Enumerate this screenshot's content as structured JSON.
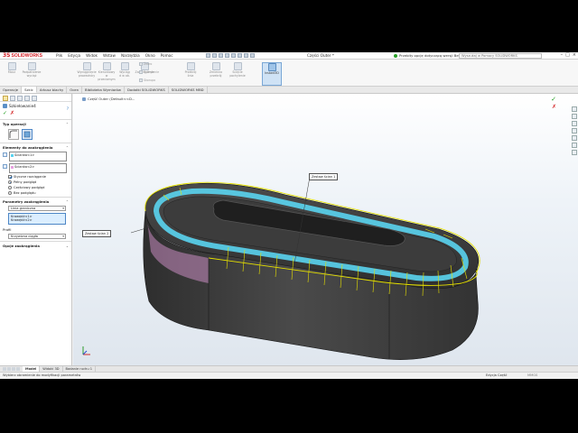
{
  "app": {
    "logo_mark": "3S",
    "logo_text": "SOLIDWORKS",
    "menu": [
      "Plik",
      "Edycja",
      "Widok",
      "Wstaw",
      "Narzędzia",
      "Okno",
      "Pomoc"
    ],
    "document_title": "Części Outer *",
    "status_text": "Przebity opcję dotyczącą wersji Beta",
    "search_placeholder": "Wyszukaj w Pomocy SOLIDWORKS",
    "win_controls": [
      "–",
      "□",
      "×"
    ]
  },
  "command_manager": {
    "large": [
      {
        "label": "Mocz",
        "icon": "mold-icon"
      },
      {
        "label": "Podpatrzenie\nwyciąż",
        "icon": "extrude-icon"
      },
      {
        "label": "Wyciągnięcie\nprowadnicy",
        "icon": "sweep-icon"
      },
      {
        "label": "Kierunkowy\nw przeciwnym",
        "icon": "direction-icon"
      },
      {
        "label": "Wyciąg\nd w ob.",
        "icon": "cut-icon"
      },
      {
        "label": "Zaokrąglenie",
        "icon": "fillet-icon"
      },
      {
        "label": "Szyk\nliniowy",
        "icon": "pattern-icon"
      },
      {
        "label": "Przekrój\nlinia",
        "icon": "section-icon"
      },
      {
        "label": "Zmienno\nprzekrój",
        "icon": "variable-icon"
      },
      {
        "label": "Ścięcie\npochylenie",
        "icon": "chamfer-icon"
      },
      {
        "label": "Wydaj\nkształt",
        "icon": "shape-icon"
      }
    ],
    "small": [
      {
        "label": "Żebro",
        "icon": "rib-icon"
      },
      {
        "label": "Pochylenie",
        "icon": "draft-icon"
      },
      {
        "label": "Skorupa",
        "icon": "shell-icon"
      },
      {
        "label": "Lustro odbicia",
        "icon": "mirror-icon"
      },
      {
        "label": "Wyrównanie",
        "icon": "wrap-icon"
      },
      {
        "label": "Przecięcie",
        "icon": "intersect-icon"
      }
    ],
    "active": {
      "label": "Instant3D",
      "icon": "instant3d-icon"
    }
  },
  "tabs": [
    "Operacje",
    "Szkic",
    "Arkusz blachy",
    "Ocen",
    "Biblioteka Wymiarów",
    "Dodatki SOLIDWORKS",
    "SOLIDWORKS MBD"
  ],
  "active_tab": 1,
  "property_manager": {
    "title": "Szkiełowanie4",
    "help": "?",
    "ok": "✓",
    "cancel": "✗",
    "group_type": "Typ operacji",
    "group_elements": "Elementy do zaokrąglenia",
    "set1_label": "Ścianka<1>",
    "set2_label": "Ścianka<2>",
    "tangent_label": "Styczne rozciąganie",
    "options": [
      "Pełny podgląd",
      "Częściowy podgląd",
      "Bez podglądu"
    ],
    "selected_option": 0,
    "group_params": "Parametry zaokrąglenia",
    "method_value": "Linia graniczna",
    "list_items": [
      "Krawędź<1>",
      "Krawędź<2>"
    ],
    "profile_label": "Profil",
    "profile_value": "Krzywizna ciągła",
    "group_options": "Opcje zaokrąglenia"
  },
  "viewport": {
    "breadcrumb": "Część Outer (Default<<D...",
    "ok": "✓",
    "cancel": "✗",
    "callout_1": "Zestaw ścian 2",
    "callout_2": "Zestaw ścian 1"
  },
  "bottom_tabs": [
    "Model",
    "Widoki 3D",
    "Badanie ruchu 1"
  ],
  "active_bottom_tab": 0,
  "status": {
    "message": "Wybierz obramienie do modyfikacji parametrów",
    "mode": "Edycja Część",
    "unit": "MMGS"
  },
  "colors": {
    "accent": "#d2232a",
    "highlight_set1": "#5ad4f0",
    "highlight_set2": "#e8a0e0",
    "edge_selection": "#e6e000",
    "body": "#3a3a3a"
  }
}
